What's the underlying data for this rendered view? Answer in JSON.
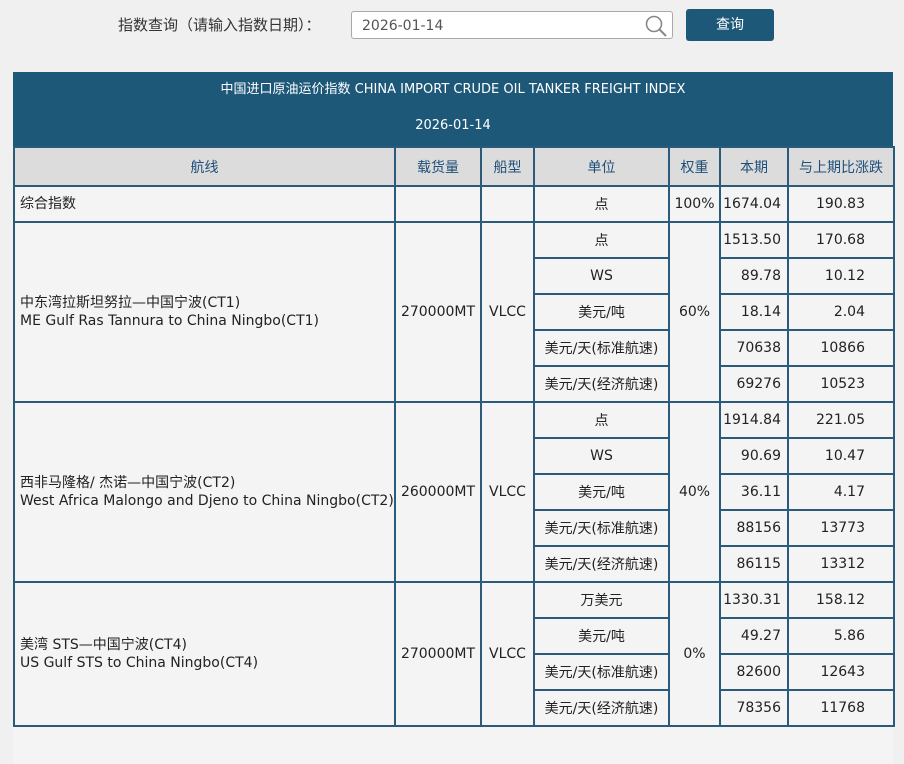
{
  "search": {
    "label": "指数查询（请输入指数日期）：",
    "date_value": "2026-01-14",
    "button_label": "查询"
  },
  "header": {
    "title": "中国进口原油运价指数 CHINA IMPORT CRUDE OIL TANKER FREIGHT INDEX",
    "date": "2026-01-14"
  },
  "columns": [
    "航线",
    "载货量",
    "船型",
    "单位",
    "权重",
    "本期",
    "与上期比涨跌"
  ],
  "composite": {
    "name": "综合指数",
    "unit": "点",
    "weight": "100%",
    "current": "1674.04",
    "change": "190.83"
  },
  "routes": [
    {
      "name_cn": "中东湾拉斯坦努拉—中国宁波(CT1)",
      "name_en": "ME Gulf Ras Tannura to China Ningbo(CT1)",
      "capacity": "270000MT",
      "vessel": "VLCC",
      "weight": "60%",
      "rows": [
        {
          "unit": "点",
          "current": "1513.50",
          "change": "170.68"
        },
        {
          "unit": "WS",
          "current": "89.78",
          "change": "10.12"
        },
        {
          "unit": "美元/吨",
          "current": "18.14",
          "change": "2.04"
        },
        {
          "unit": "美元/天(标准航速)",
          "current": "70638",
          "change": "10866"
        },
        {
          "unit": "美元/天(经济航速)",
          "current": "69276",
          "change": "10523"
        }
      ]
    },
    {
      "name_cn": "西非马隆格/ 杰诺—中国宁波(CT2)",
      "name_en": "West Africa Malongo and Djeno to China Ningbo(CT2)",
      "capacity": "260000MT",
      "vessel": "VLCC",
      "weight": "40%",
      "rows": [
        {
          "unit": "点",
          "current": "1914.84",
          "change": "221.05"
        },
        {
          "unit": "WS",
          "current": "90.69",
          "change": "10.47"
        },
        {
          "unit": "美元/吨",
          "current": "36.11",
          "change": "4.17"
        },
        {
          "unit": "美元/天(标准航速)",
          "current": "88156",
          "change": "13773"
        },
        {
          "unit": "美元/天(经济航速)",
          "current": "86115",
          "change": "13312"
        }
      ]
    },
    {
      "name_cn": "美湾 STS—中国宁波(CT4)",
      "name_en": "US Gulf STS to China Ningbo(CT4)",
      "capacity": "270000MT",
      "vessel": "VLCC",
      "weight": "0%",
      "rows": [
        {
          "unit": "万美元",
          "current": "1330.31",
          "change": "158.12"
        },
        {
          "unit": "美元/吨",
          "current": "49.27",
          "change": "5.86"
        },
        {
          "unit": "美元/天(标准航速)",
          "current": "82600",
          "change": "12643"
        },
        {
          "unit": "美元/天(经济航速)",
          "current": "78356",
          "change": "11768"
        }
      ]
    }
  ]
}
